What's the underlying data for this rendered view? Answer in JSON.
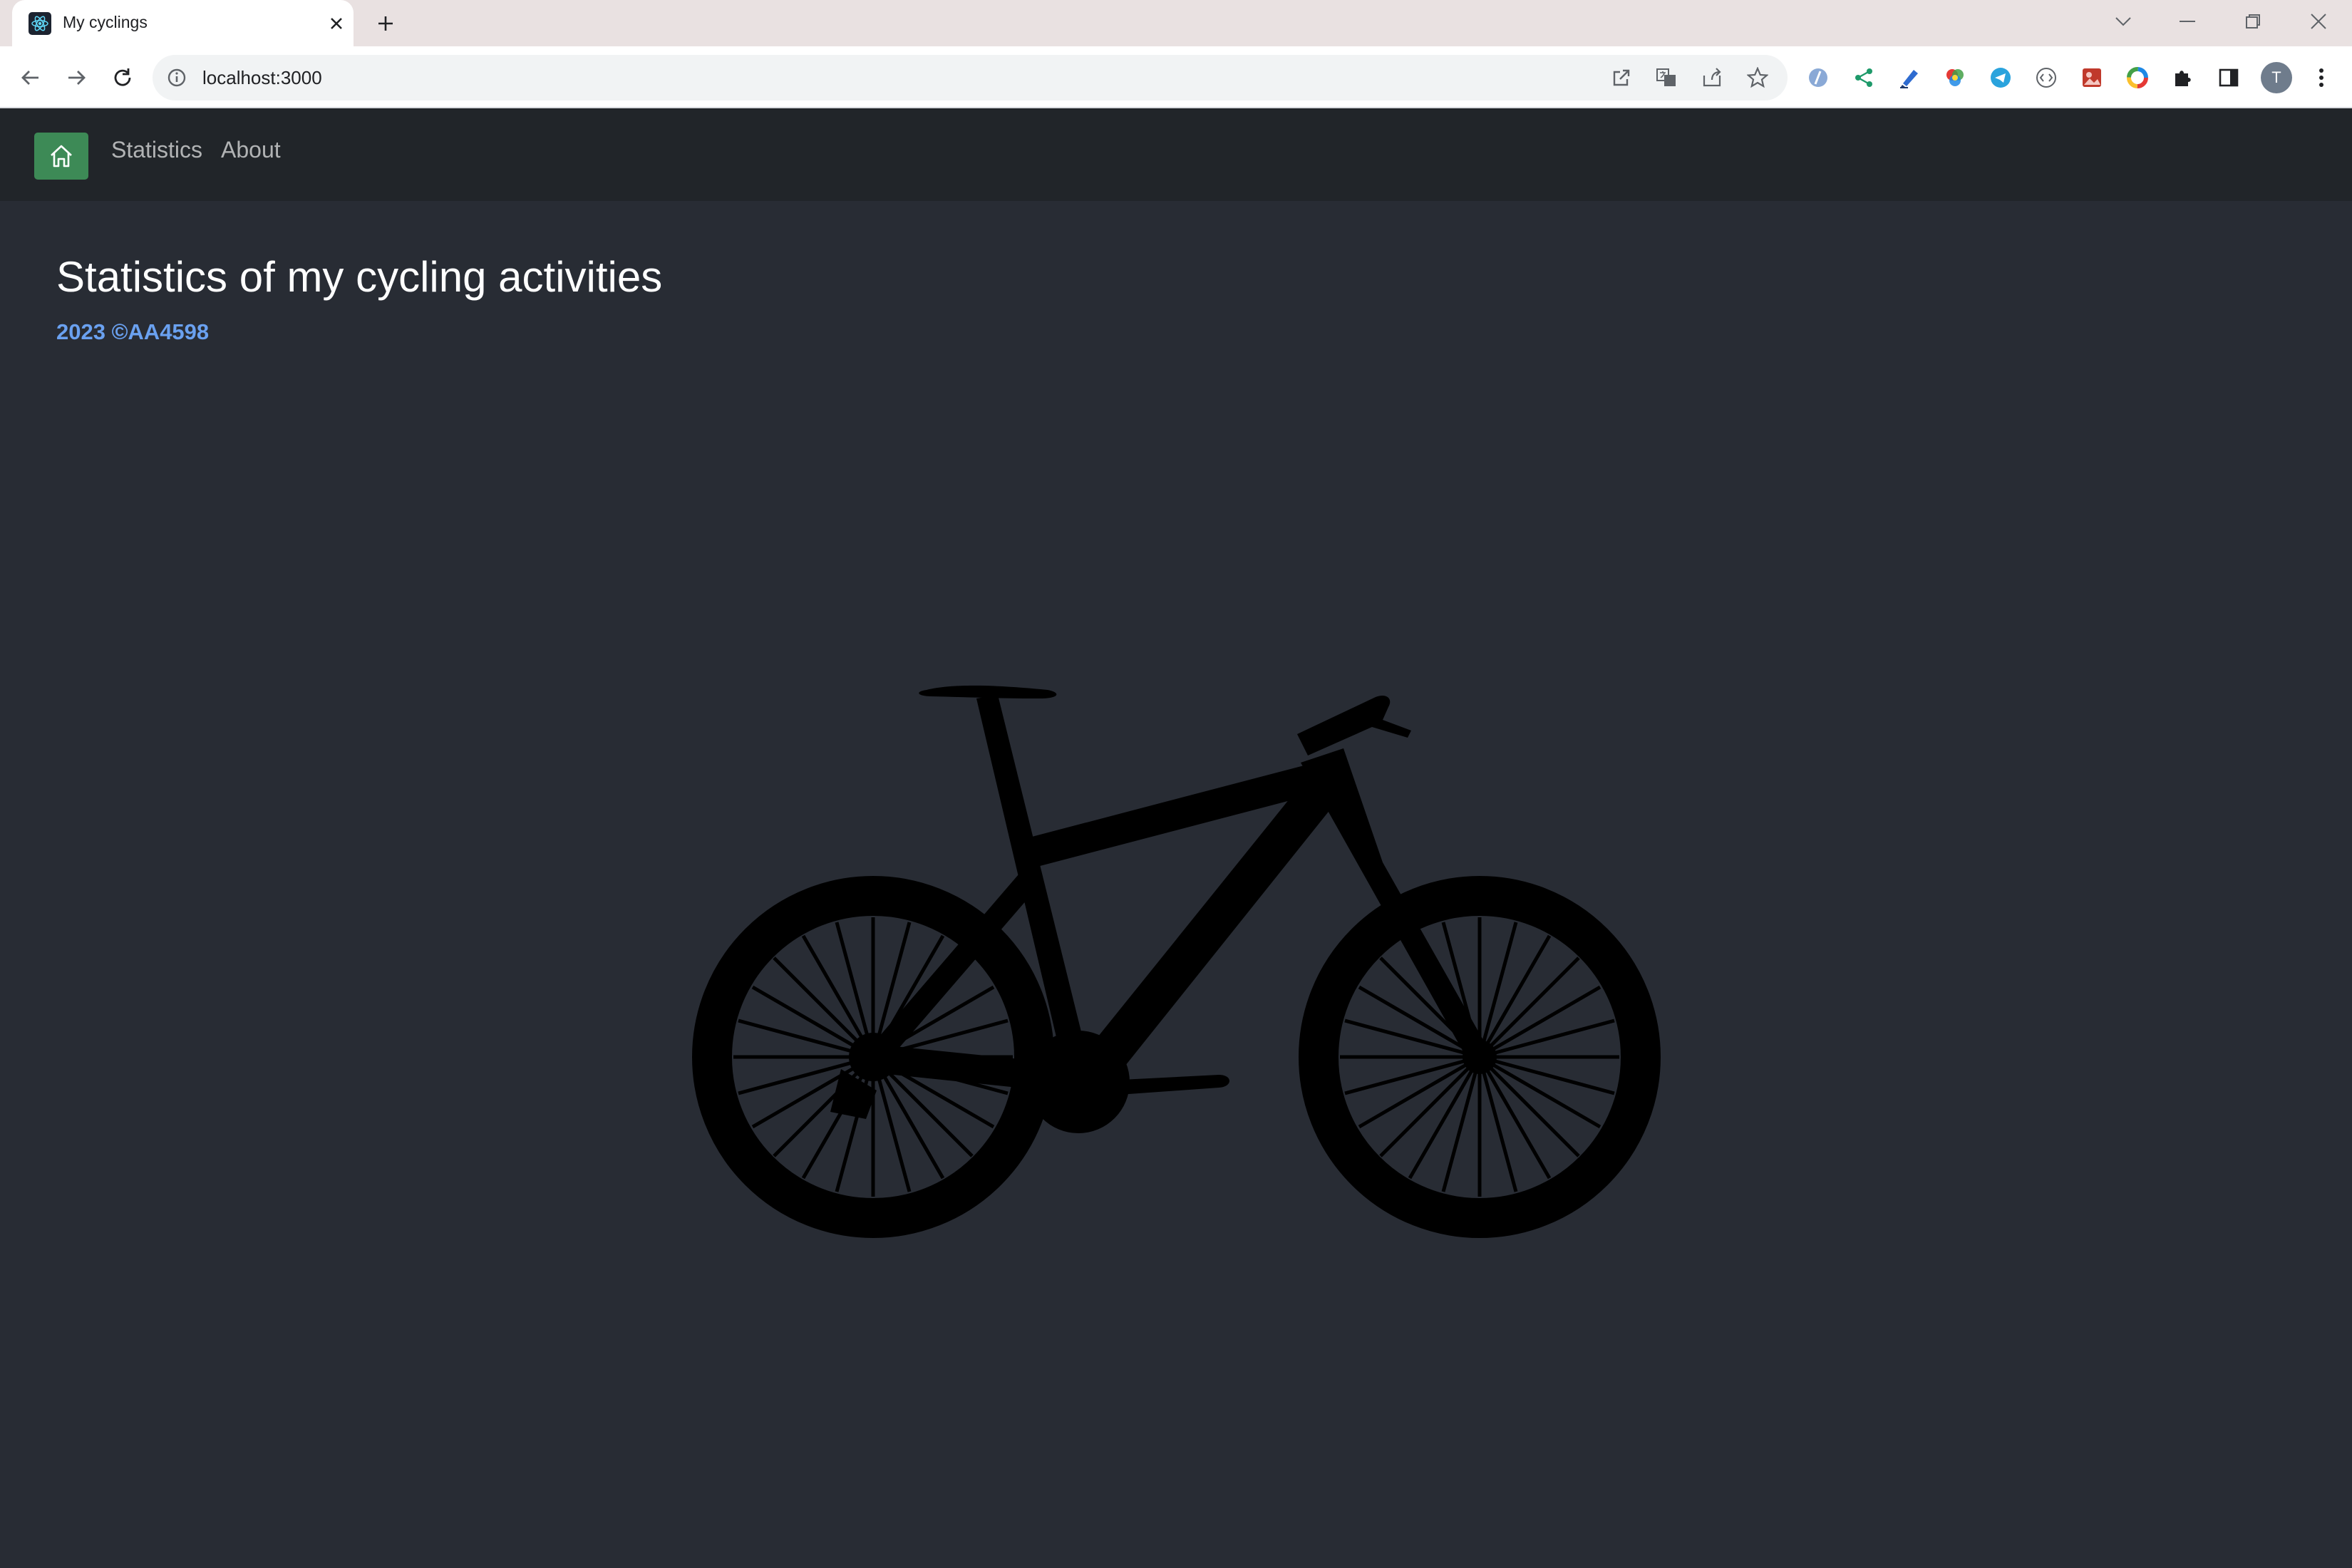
{
  "browser": {
    "tab_title": "My cyclings",
    "url": "localhost:3000",
    "profile_initial": "T"
  },
  "navbar": {
    "links": [
      "Statistics",
      "About"
    ]
  },
  "main": {
    "title": "Statistics of my cycling activities",
    "copyright": "2023 ©AA4598"
  },
  "colors": {
    "page_background": "#282c34",
    "navbar_background": "#212529",
    "home_button": "#3d8a56",
    "copyright_text": "#6aa1f0"
  },
  "icons": [
    "react-favicon-icon",
    "close-icon",
    "plus-icon",
    "chevron-down-icon",
    "minimize-icon",
    "restore-icon",
    "back-arrow-icon",
    "forward-arrow-icon",
    "reload-icon",
    "info-icon",
    "open-external-icon",
    "translate-icon",
    "share-icon",
    "star-icon",
    "extensions-icon",
    "side-panel-icon",
    "more-vert-icon",
    "home-icon",
    "bicycle-icon"
  ]
}
